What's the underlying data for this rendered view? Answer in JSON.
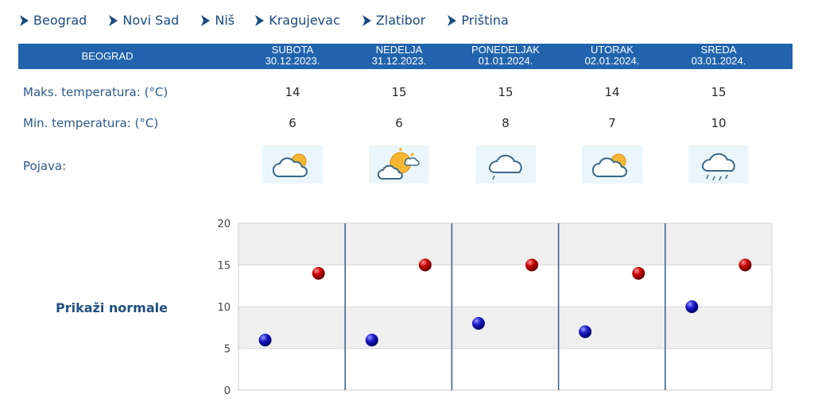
{
  "nav": {
    "cities": [
      "Beograd",
      "Novi Sad",
      "Niš",
      "Kragujevac",
      "Zlatibor",
      "Priština"
    ]
  },
  "table": {
    "city": "BEOGRAD",
    "days": [
      {
        "name": "SUBOTA",
        "date": "30.12.2023.",
        "max": "14",
        "min": "6",
        "icon": "partly-cloudy-icon"
      },
      {
        "name": "NEDELJA",
        "date": "31.12.2023.",
        "max": "15",
        "min": "6",
        "icon": "mostly-sunny-icon"
      },
      {
        "name": "PONEDELJAK",
        "date": "01.01.2024.",
        "max": "15",
        "min": "8",
        "icon": "cloud-drizzle-icon"
      },
      {
        "name": "UTORAK",
        "date": "02.01.2024.",
        "max": "14",
        "min": "7",
        "icon": "partly-cloudy-icon"
      },
      {
        "name": "SREDA",
        "date": "03.01.2024.",
        "max": "15",
        "min": "10",
        "icon": "cloud-rain-icon"
      }
    ],
    "labels": {
      "max": "Maks. temperatura: (°C)",
      "min": "Min. temperatura: (°C)",
      "phenomenon": "Pojava:"
    }
  },
  "normals_label": "Prikaži normale",
  "colors": {
    "header_bg": "#2163ad",
    "max_dot": "#cc0000",
    "min_dot": "#1a1acc"
  },
  "chart_data": {
    "type": "scatter",
    "categories": [
      "30.12.2023.",
      "31.12.2023.",
      "01.01.2024.",
      "02.01.2024.",
      "03.01.2024."
    ],
    "series": [
      {
        "values": [
          14,
          15,
          15,
          14,
          15
        ]
      },
      {
        "values": [
          6,
          6,
          8,
          7,
          10
        ]
      }
    ],
    "ylim": [
      0,
      20
    ],
    "yticks": [
      0,
      5,
      10,
      15,
      20
    ],
    "grid": true
  }
}
